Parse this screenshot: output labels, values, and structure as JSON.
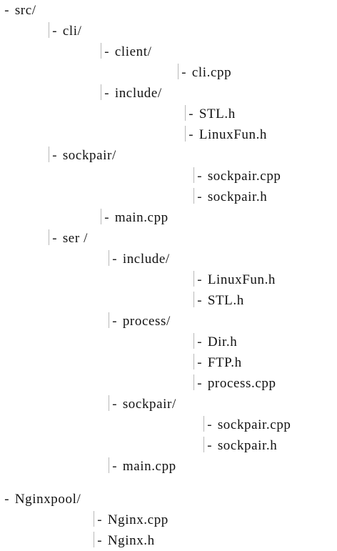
{
  "tree": [
    {
      "text": "src/",
      "pipe": false,
      "kind": "folder"
    },
    {
      "text": "cli/",
      "pipe": true,
      "kind": "folder"
    },
    {
      "text": "client/",
      "pipe": true,
      "kind": "folder"
    },
    {
      "text": "cli.cpp",
      "pipe": true,
      "kind": "file"
    },
    {
      "text": "include/",
      "pipe": true,
      "kind": "folder"
    },
    {
      "text": "STL.h",
      "pipe": true,
      "kind": "file"
    },
    {
      "text": "LinuxFun.h",
      "pipe": true,
      "kind": "file"
    },
    {
      "text": "sockpair/",
      "pipe": true,
      "kind": "folder"
    },
    {
      "text": "sockpair.cpp",
      "pipe": true,
      "kind": "file"
    },
    {
      "text": "sockpair.h",
      "pipe": true,
      "kind": "file"
    },
    {
      "text": "main.cpp",
      "pipe": true,
      "kind": "file"
    },
    {
      "text": "ser /",
      "pipe": true,
      "kind": "folder"
    },
    {
      "text": "include/",
      "pipe": true,
      "kind": "folder"
    },
    {
      "text": "LinuxFun.h",
      "pipe": true,
      "kind": "file"
    },
    {
      "text": "STL.h",
      "pipe": true,
      "kind": "file"
    },
    {
      "text": "process/",
      "pipe": true,
      "kind": "folder"
    },
    {
      "text": "Dir.h",
      "pipe": true,
      "kind": "file"
    },
    {
      "text": "FTP.h",
      "pipe": true,
      "kind": "file"
    },
    {
      "text": "process.cpp",
      "pipe": true,
      "kind": "file"
    },
    {
      "text": "sockpair/",
      "pipe": true,
      "kind": "folder"
    },
    {
      "text": "sockpair.cpp",
      "pipe": true,
      "kind": "file"
    },
    {
      "text": "sockpair.h",
      "pipe": true,
      "kind": "file"
    },
    {
      "text": "main.cpp",
      "pipe": true,
      "kind": "file"
    },
    {
      "text": "Nginxpool/",
      "pipe": false,
      "kind": "folder"
    },
    {
      "text": "Nginx.cpp",
      "pipe": true,
      "kind": "file"
    },
    {
      "text": "Nginx.h",
      "pipe": true,
      "kind": "file"
    }
  ],
  "dash_glyph": "-",
  "colors": {
    "text": "#111111",
    "guide_line": "#b8b8b8",
    "background": "#ffffff"
  }
}
